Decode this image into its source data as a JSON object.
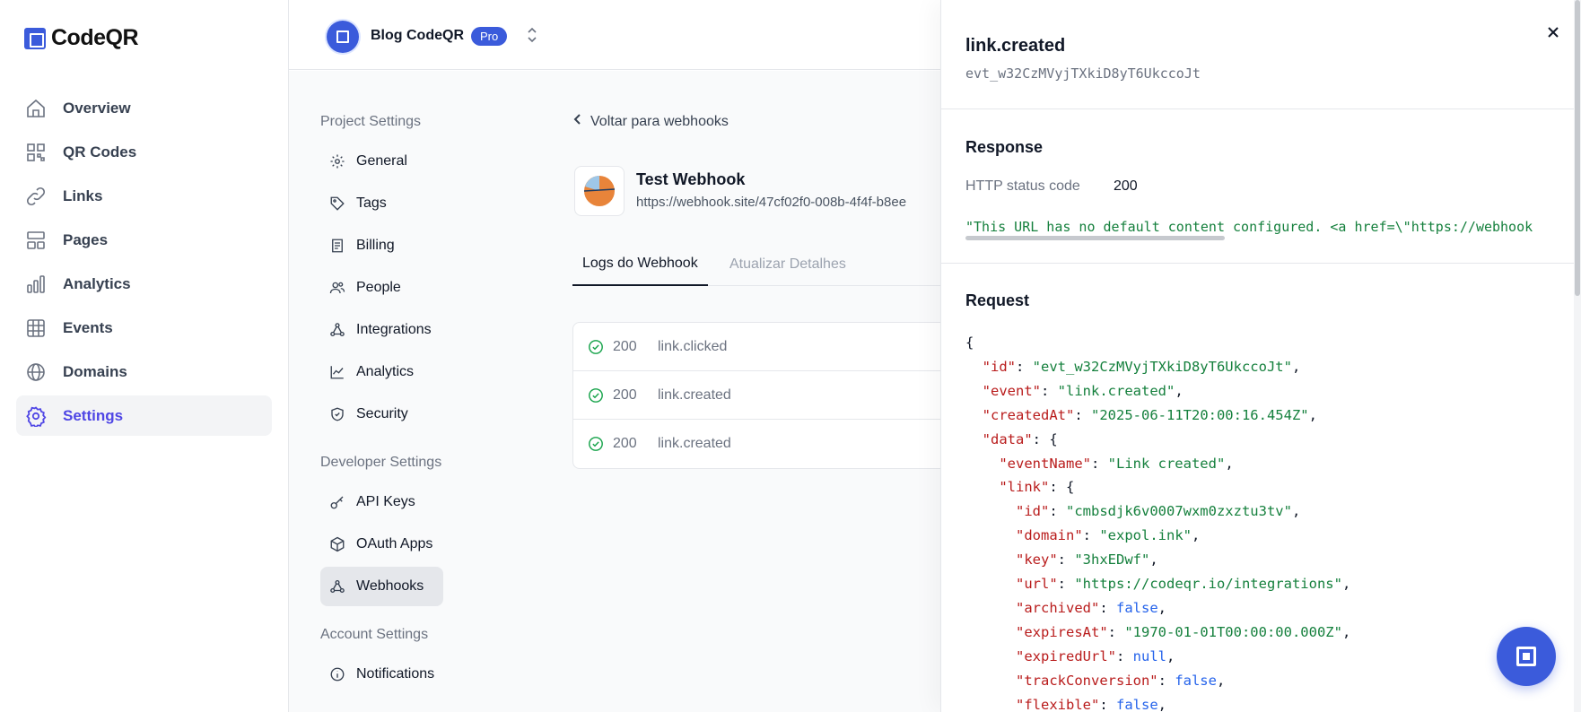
{
  "app": {
    "name": "CodeQR"
  },
  "sidebar": {
    "items": [
      {
        "label": "Overview",
        "icon": "home-icon"
      },
      {
        "label": "QR Codes",
        "icon": "qr-code-icon"
      },
      {
        "label": "Links",
        "icon": "link-icon"
      },
      {
        "label": "Pages",
        "icon": "pages-icon"
      },
      {
        "label": "Analytics",
        "icon": "bar-chart-icon"
      },
      {
        "label": "Events",
        "icon": "grid-icon"
      },
      {
        "label": "Domains",
        "icon": "globe-icon"
      },
      {
        "label": "Settings",
        "icon": "gear-icon",
        "active": true
      }
    ]
  },
  "header": {
    "workspace": "Blog CodeQR",
    "plan_badge": "Pro"
  },
  "settings_nav": {
    "project_heading": "Project Settings",
    "project_items": [
      "General",
      "Tags",
      "Billing",
      "People",
      "Integrations",
      "Analytics",
      "Security"
    ],
    "developer_heading": "Developer Settings",
    "developer_items": [
      "API Keys",
      "OAuth Apps",
      "Webhooks"
    ],
    "account_heading": "Account Settings",
    "account_items": [
      "Notifications"
    ],
    "active": "Webhooks"
  },
  "webhook": {
    "back_label": "Voltar para webhooks",
    "name": "Test Webhook",
    "url": "https://webhook.site/47cf02f0-008b-4f4f-b8ee",
    "tabs": [
      "Logs do Webhook",
      "Atualizar Detalhes"
    ],
    "logs": [
      {
        "status": "200",
        "event": "link.clicked"
      },
      {
        "status": "200",
        "event": "link.created"
      },
      {
        "status": "200",
        "event": "link.created"
      }
    ]
  },
  "panel": {
    "title": "link.created",
    "event_id": "evt_w32CzMVyjTXkiD8yT6UkccoJt",
    "response_heading": "Response",
    "status_label": "HTTP status code",
    "status_value": "200",
    "response_body": "\"This URL has no default content configured. <a href=\\\"https://webhook",
    "request_heading": "Request",
    "request": {
      "id": "evt_w32CzMVyjTXkiD8yT6UkccoJt",
      "event": "link.created",
      "createdAt": "2025-06-11T20:00:16.454Z",
      "eventName": "Link created",
      "link_id": "cmbsdjk6v0007wxm0zxztu3tv",
      "domain": "expol.ink",
      "key": "3hxEDwf",
      "url": "https://codeqr.io/integrations",
      "archived": "false",
      "expiresAt": "1970-01-01T00:00:00.000Z",
      "expiredUrl": "null",
      "trackConversion": "false",
      "flexible": "false"
    }
  },
  "colors": {
    "accent": "#3b5bdb",
    "active_nav": "#4f46e5",
    "json_key": "#b91c1c",
    "json_string": "#15803d",
    "json_literal": "#2563eb"
  }
}
